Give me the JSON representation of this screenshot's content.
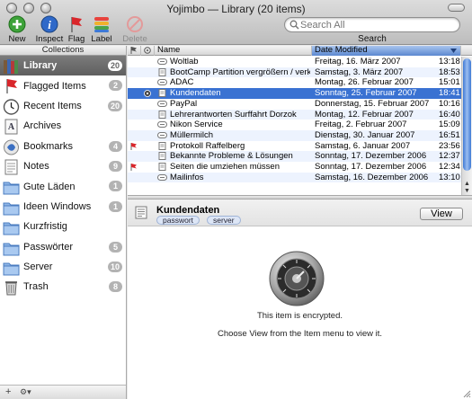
{
  "window": {
    "title": "Yojimbo — Library (20 items)"
  },
  "toolbar": {
    "items": [
      {
        "label": "New",
        "icon": "new-plus-icon"
      },
      {
        "label": "Inspect",
        "icon": "info-icon"
      },
      {
        "label": "Flag",
        "icon": "flag-icon"
      },
      {
        "label": "Label",
        "icon": "label-icon"
      },
      {
        "label": "Delete",
        "icon": "delete-icon",
        "disabled": true
      }
    ],
    "search_placeholder": "Search All",
    "search_label": "Search"
  },
  "sidebar": {
    "header": "Collections",
    "items": [
      {
        "label": "Library",
        "count": "20",
        "icon": "library-books-icon",
        "selected": true
      },
      {
        "label": "Flagged Items",
        "count": "2",
        "icon": "flag-icon"
      },
      {
        "label": "Recent Items",
        "count": "20",
        "icon": "clock-icon"
      },
      {
        "label": "Archives",
        "count": "",
        "icon": "archive-icon"
      },
      {
        "label": "Bookmarks",
        "count": "4",
        "icon": "bookmark-icon"
      },
      {
        "label": "Notes",
        "count": "9",
        "icon": "note-icon"
      },
      {
        "label": "Gute Läden",
        "count": "1",
        "icon": "folder-icon"
      },
      {
        "label": "Ideen Windows",
        "count": "1",
        "icon": "folder-icon"
      },
      {
        "label": "Kurzfristig",
        "count": "",
        "icon": "folder-icon"
      },
      {
        "label": "Passwörter",
        "count": "5",
        "icon": "folder-icon"
      },
      {
        "label": "Server",
        "count": "10",
        "icon": "folder-icon"
      },
      {
        "label": "Trash",
        "count": "8",
        "icon": "trash-icon"
      }
    ],
    "footer": {
      "add": "+",
      "action": "⚙▾"
    }
  },
  "table": {
    "columns": {
      "name": "Name",
      "date": "Date Modified"
    },
    "rows": [
      {
        "name": "Woltlab",
        "date": "Freitag, 16. März 2007",
        "time": "13:18",
        "kind": "serial",
        "flag": false
      },
      {
        "name": "BootCamp Partition vergrößern / verkleinern",
        "date": "Samstag, 3. März 2007",
        "time": "18:53",
        "kind": "note",
        "flag": false
      },
      {
        "name": "ADAC",
        "date": "Montag, 26. Februar 2007",
        "time": "15:01",
        "kind": "serial",
        "flag": false
      },
      {
        "name": "Kundendaten",
        "date": "Sonntag, 25. Februar 2007",
        "time": "18:41",
        "kind": "note",
        "flag": false,
        "encrypted": true,
        "selected": true
      },
      {
        "name": "PayPal",
        "date": "Donnerstag, 15. Februar 2007",
        "time": "10:16",
        "kind": "serial",
        "flag": false
      },
      {
        "name": "Lehrerantworten Surffahrt Dorzok",
        "date": "Montag, 12. Februar 2007",
        "time": "16:40",
        "kind": "note",
        "flag": false
      },
      {
        "name": "Nikon Service",
        "date": "Freitag, 2. Februar 2007",
        "time": "15:09",
        "kind": "serial",
        "flag": false
      },
      {
        "name": "Müllermilch",
        "date": "Dienstag, 30. Januar 2007",
        "time": "16:51",
        "kind": "serial",
        "flag": false
      },
      {
        "name": "Protokoll Raffelberg",
        "date": "Samstag, 6. Januar 2007",
        "time": "23:56",
        "kind": "note",
        "flag": true
      },
      {
        "name": "Bekannte Probleme & Lösungen",
        "date": "Sonntag, 17. Dezember 2006",
        "time": "12:37",
        "kind": "note",
        "flag": false
      },
      {
        "name": "Seiten die umziehen müssen",
        "date": "Sonntag, 17. Dezember 2006",
        "time": "12:34",
        "kind": "note",
        "flag": true
      },
      {
        "name": "Mailinfos",
        "date": "Samstag, 16. Dezember 2006",
        "time": "13:10",
        "kind": "serial",
        "flag": false
      }
    ]
  },
  "detail": {
    "title": "Kundendaten",
    "tags": [
      "passwort",
      "server"
    ],
    "view_button": "View",
    "encrypted_msg": "This item is encrypted.",
    "instruction": "Choose View from the Item menu to view it."
  },
  "colors": {
    "selection": "#3a72d2",
    "alt_row": "#edf3fe",
    "sidebar_selection": "#6b6b6b"
  }
}
